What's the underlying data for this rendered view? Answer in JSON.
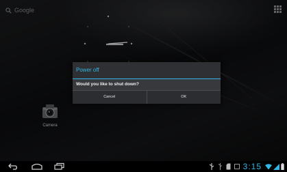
{
  "search": {
    "label": "Google"
  },
  "camera": {
    "label": "Camera"
  },
  "dialog": {
    "title": "Power off",
    "message": "Would you like to shut down?",
    "cancel_label": "Cancel",
    "ok_label": "OK"
  },
  "statusbar": {
    "time": "3:15"
  },
  "colors": {
    "accent": "#33b5e5",
    "dialog_bg": "#2e3033"
  },
  "icons": [
    "search-icon",
    "apps-grid-icon",
    "camera-icon",
    "back-icon",
    "home-icon",
    "recent-apps-icon",
    "usb-icon",
    "sd-card-icon",
    "screenshot-icon",
    "wifi-icon",
    "signal-icon",
    "battery-icon"
  ]
}
